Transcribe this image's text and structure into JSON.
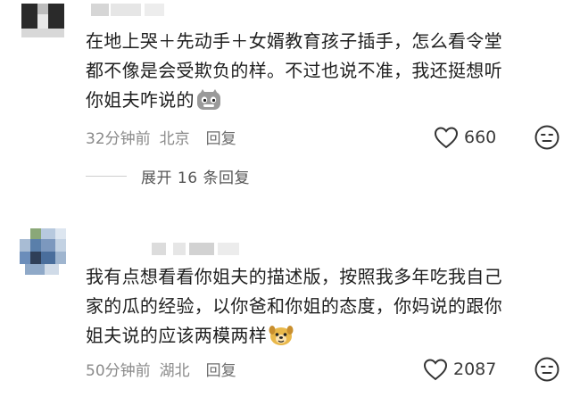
{
  "comments": [
    {
      "text_lines": [
        "在地上哭＋先动手＋女婿教育孩子插手，怎么看令堂",
        "都不像是会受欺负的样。不过也说不准，我还挺想听",
        "你姐夫咋说的"
      ],
      "emoji": "cat-emoji",
      "time": "32分钟前",
      "location": "北京",
      "reply_label": "回复",
      "likes": "660"
    },
    {
      "text_lines": [
        "我有点想看看你姐夫的描述版，按照我多年吃我自己",
        "家的瓜的经验，以你爸和你姐的态度，你妈说的跟你",
        "姐夫说的应该两模两样"
      ],
      "emoji": "dog-emoji",
      "time": "50分钟前",
      "location": "湖北",
      "reply_label": "回复",
      "likes": "2087"
    }
  ],
  "expand_replies": {
    "label": "展开 16 条回复"
  },
  "colors": {
    "meta_gray": "#8a8a8a",
    "text": "#1f1f1f"
  }
}
